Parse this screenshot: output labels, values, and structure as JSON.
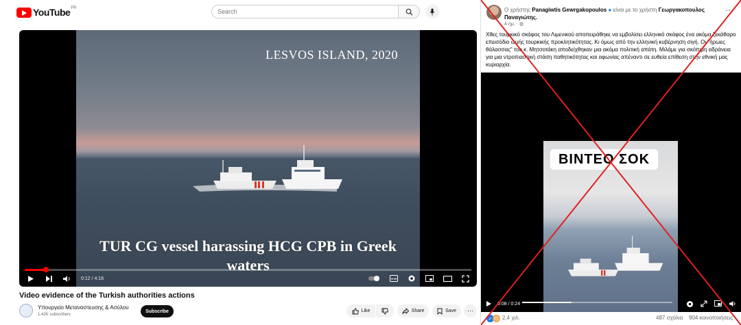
{
  "youtube": {
    "logo_text": "YouTube",
    "region": "FR",
    "search_placeholder": "Search",
    "video": {
      "overlay_top": "LESVOS ISLAND,  2020",
      "overlay_bottom_line1": "TUR CG vessel harassing  HCG CPB in Greek",
      "overlay_bottom_line2": "waters",
      "time": "0:12 / 4:16",
      "progress": 0.047
    },
    "title": "Video evidence of the Turkish authorities actions",
    "channel": "Υπουργείο Μεταναστευσης & Ασύλου",
    "subscribers": "1.42K subscribers",
    "subscribe_label": "Subscribe",
    "like_label": "Like",
    "share_label": "Share",
    "save_label": "Save"
  },
  "facebook": {
    "head_prefix": "Ο χρήστης",
    "author": "Panagiwtis Gewrgakopoulos",
    "head_mid": "είναι με το χρήστη",
    "tagged": "Γεωργακοπουλος Παναγιώτης",
    "time": "4 ημ. ·",
    "post_text": "Χθες τουρκικό σκάφος του Λιμενικού αποπειράθηκε να εμβολίσει ελληνικό σκάφος  ένα ακόμα ξεκάθαρο επεισόδιο ωμής τουρκικής προκλητικότητας. Κι όμως από την ελληνική κυβέρνηση σιγή. Οι \"ήρωες θάλασσας\" του κ. Μητσοτάκη αποδείχθηκαν μια ακόμα πολιτική απάτη. Μιλάμε για σκόπιμη αδράνεια για μια ντροπιαστική στάση παθητικότητας και αφωνίας απέναντι σε ευθεία επίθεση στην εθνική μας κυριαρχία.",
    "video_badge": "ΒΙΝΤΕΟ ΣΟΚ",
    "video_time": "0:08 / 0:24",
    "video_progress": 0.33,
    "reactions": "2,4 χιλ.",
    "comments": "487 σχόλια",
    "shares": "904 κοινοποιήσεις"
  },
  "colors": {
    "yt_red": "#ff0000",
    "fake_cross": "#e02020",
    "fb_blue": "#1877f2"
  }
}
